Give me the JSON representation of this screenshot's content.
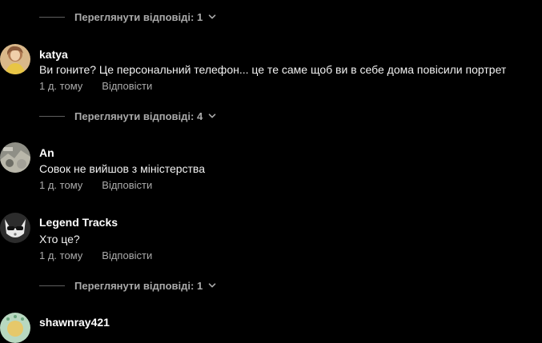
{
  "colors": {
    "background": "#000000",
    "text_primary": "#ffffff",
    "text_secondary": "#aaaaaa"
  },
  "icons": {
    "replies_toggle": "chevron-down-icon"
  },
  "threads": [
    {
      "view_replies": "Переглянути відповіді: 1"
    },
    {
      "author": "katya",
      "text": "Ви гоните? Це персональний телефон... це те саме щоб ви в себе дома повісили портрет",
      "time": "1 д. тому",
      "reply_label": "Відповісти",
      "view_replies": "Переглянути відповіді: 4"
    },
    {
      "author": "An",
      "text": "Совок не вийшов з міністерства",
      "time": "1 д. тому",
      "reply_label": "Відповісти"
    },
    {
      "author": "Legend Tracks",
      "text": "Хто це?",
      "time": "1 д. тому",
      "reply_label": "Відповісти",
      "view_replies": "Переглянути відповіді: 1"
    },
    {
      "author": "shawnray421"
    }
  ]
}
